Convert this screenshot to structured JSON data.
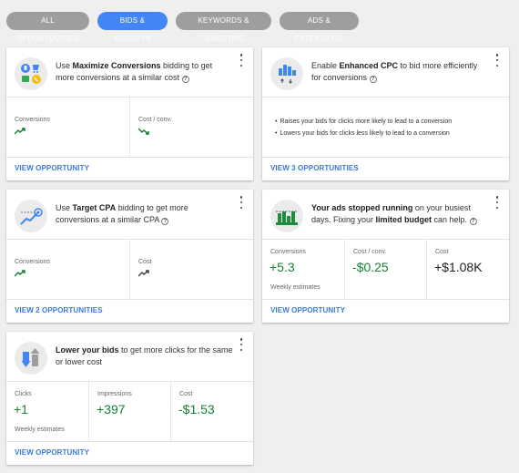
{
  "tabs": [
    {
      "label": "ALL OPPORTUNITIES",
      "active": false
    },
    {
      "label": "BIDS & BUDGETS",
      "active": true
    },
    {
      "label": "KEYWORDS & TARGETING",
      "active": false
    },
    {
      "label": "ADS & EXTENSIONS",
      "active": false
    }
  ],
  "colors": {
    "accent": "#4285f4",
    "positive": "#188038",
    "link": "#3c78d8"
  },
  "cards": {
    "max_conv": {
      "icon": "maximize-conversions-icon",
      "pre": "Use ",
      "bold": "Maximize Conversions",
      "post": " bidding to get more conversions at a similar cost",
      "metrics": [
        {
          "label": "Conversions",
          "trend": "up"
        },
        {
          "label": "Cost / conv.",
          "trend": "down"
        }
      ],
      "action": "VIEW OPPORTUNITY"
    },
    "ecpc": {
      "icon": "enhanced-cpc-icon",
      "pre": "Enable ",
      "bold": "Enhanced CPC",
      "post": " to bid more efficiently for conversions",
      "bullets": [
        "Raises your bids for clicks more likely to lead to a conversion",
        "Lowers your bids for clicks less likely to lead to a conversion"
      ],
      "action": "VIEW 3 OPPORTUNITIES"
    },
    "tcpa": {
      "icon": "target-cpa-icon",
      "pre": "Use ",
      "bold": "Target CPA",
      "post": " bidding to get more conversions at a similar CPA",
      "metrics": [
        {
          "label": "Conversions",
          "trend": "up"
        },
        {
          "label": "Cost",
          "trend": "up"
        }
      ],
      "action": "VIEW 2 OPPORTUNITIES"
    },
    "budget": {
      "icon": "limited-budget-icon",
      "bold1": "Your ads stopped running",
      "mid": " on your busiest days. Fixing your ",
      "bold2": "limited budget",
      "post": " can help.",
      "metrics": [
        {
          "label": "Conversions",
          "value": "+5.3"
        },
        {
          "label": "Cost / conv.",
          "value": "-$0.25"
        },
        {
          "label": "Cost",
          "value": "+$1.08K"
        }
      ],
      "footnote": "Weekly estimates",
      "action": "VIEW OPPORTUNITY"
    },
    "lower": {
      "icon": "lower-bids-icon",
      "bold": "Lower your bids",
      "post": " to get more clicks for the same or lower cost",
      "metrics": [
        {
          "label": "Clicks",
          "value": "+1"
        },
        {
          "label": "Impressions",
          "value": "+397"
        },
        {
          "label": "Cost",
          "value": "-$1.53"
        }
      ],
      "footnote": "Weekly estimates",
      "action": "VIEW OPPORTUNITY"
    }
  }
}
